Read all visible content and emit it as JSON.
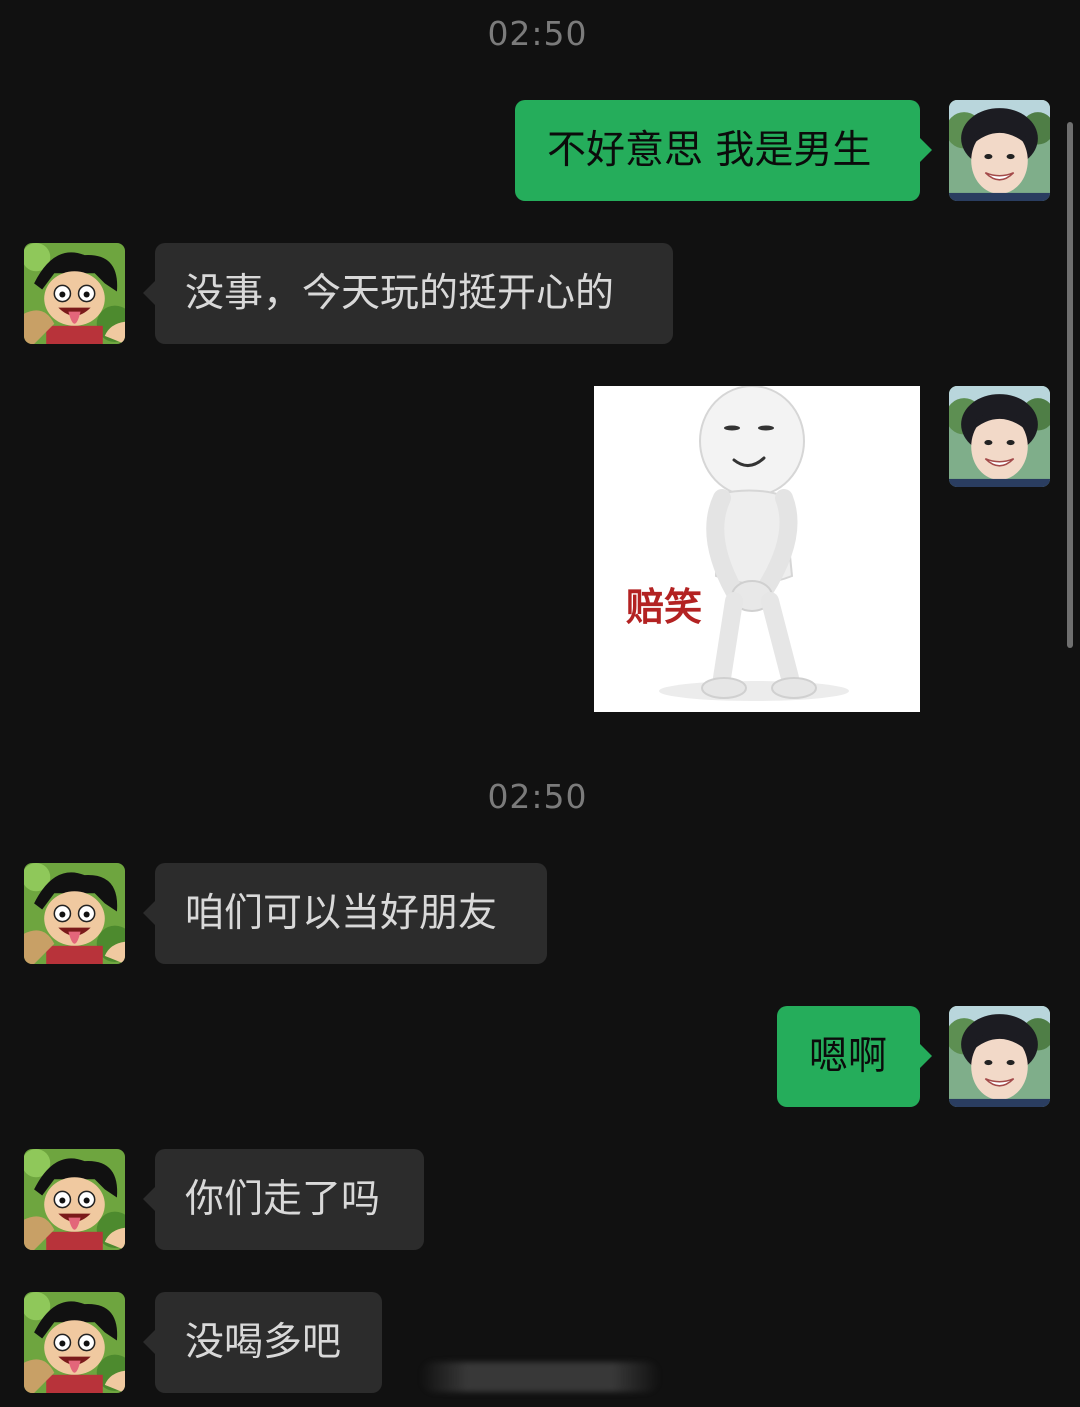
{
  "timestamps": [
    "02:50",
    "02:50"
  ],
  "messages": [
    {
      "sender": "me",
      "type": "text",
      "text": "不好意思 我是男生"
    },
    {
      "sender": "other",
      "type": "text",
      "text": "没事，今天玩的挺开心的"
    },
    {
      "sender": "me",
      "type": "sticker",
      "caption": "赔笑"
    },
    {
      "sender": "other",
      "type": "text",
      "text": "咱们可以当好朋友"
    },
    {
      "sender": "me",
      "type": "text",
      "text": "嗯啊"
    },
    {
      "sender": "other",
      "type": "text",
      "text": "你们走了吗"
    },
    {
      "sender": "other",
      "type": "text",
      "text": "没喝多吧"
    }
  ],
  "avatars": {
    "me": {
      "icon": "smiling-person-avatar-icon"
    },
    "other": {
      "icon": "cartoon-character-avatar-icon"
    }
  },
  "colors": {
    "background": "#111111",
    "incoming_bubble": "#2c2c2c",
    "outgoing_bubble": "#25ad5b",
    "timestamp": "#7b7b7b"
  }
}
